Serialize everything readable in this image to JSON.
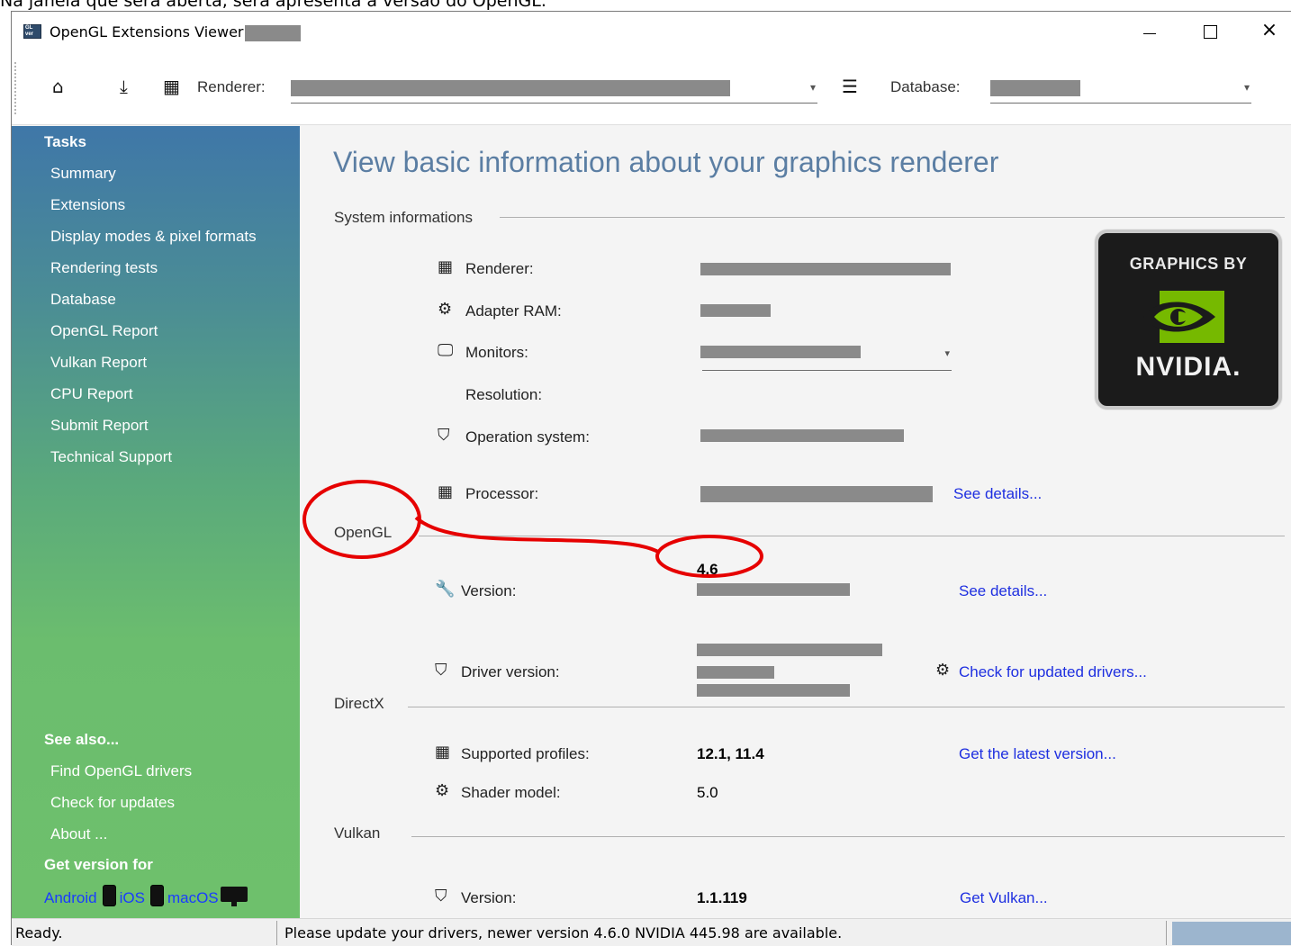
{
  "caption": "Na janela que será aberta, será apresenta a versão do OpenGL.",
  "window": {
    "title": "OpenGL Extensions Viewer -",
    "app_icon": "app-icon",
    "controls": {
      "minimize": "minimize-icon",
      "maximize": "maximize-icon",
      "close": "×"
    }
  },
  "toolbar": {
    "home_icon": "⌂",
    "download_icon": "⤓",
    "renderer_icon": "▦",
    "renderer_label": "Renderer:",
    "database_icon": "☰",
    "database_label": "Database:",
    "dropdown_caret": "▾"
  },
  "sidebar": {
    "tasks_heading": "Tasks",
    "tasks": [
      "Summary",
      "Extensions",
      "Display modes & pixel formats",
      "Rendering tests",
      "Database",
      "OpenGL Report",
      "Vulkan Report",
      "CPU Report",
      "Submit Report",
      "Technical Support"
    ],
    "see_also_heading": "See also...",
    "see_also": [
      "Find OpenGL drivers",
      "Check for updates",
      "About ..."
    ],
    "get_version_heading": "Get version for",
    "platforms": [
      "Android",
      "iOS",
      "macOS"
    ]
  },
  "content": {
    "page_title": "View basic information about your graphics renderer",
    "system": {
      "heading": "System informations",
      "renderer_label": "Renderer:",
      "adapter_ram_label": "Adapter RAM:",
      "monitors_label": "Monitors:",
      "resolution_label": "Resolution:",
      "os_label": "Operation system:",
      "processor_label": "Processor:",
      "processor_link": "See details..."
    },
    "opengl": {
      "heading": "OpenGL",
      "version_value": "4.6",
      "version_label": "Version:",
      "version_link": "See details...",
      "driver_label": "Driver version:",
      "driver_link": "Check for updated drivers..."
    },
    "directx": {
      "heading": "DirectX",
      "profiles_label": "Supported profiles:",
      "profiles_value": "12.1, 11.4",
      "profiles_link": "Get the latest version...",
      "shader_label": "Shader model:",
      "shader_value": "5.0"
    },
    "vulkan": {
      "heading": "Vulkan",
      "version_label": "Version:",
      "version_value": "1.1.119",
      "version_link": "Get Vulkan..."
    },
    "badge": {
      "top": "GRAPHICS BY",
      "bottom": "NVIDIA."
    }
  },
  "statusbar": {
    "state": "Ready.",
    "message": "Please update your drivers, newer version 4.6.0 NVIDIA 445.98 are available."
  },
  "colors": {
    "annotation": "#e60000",
    "title_blue": "#5b7ea3",
    "link_blue": "#1e2fe0",
    "sidebar_top": "#3f77a8",
    "sidebar_bottom": "#6ec06c"
  }
}
